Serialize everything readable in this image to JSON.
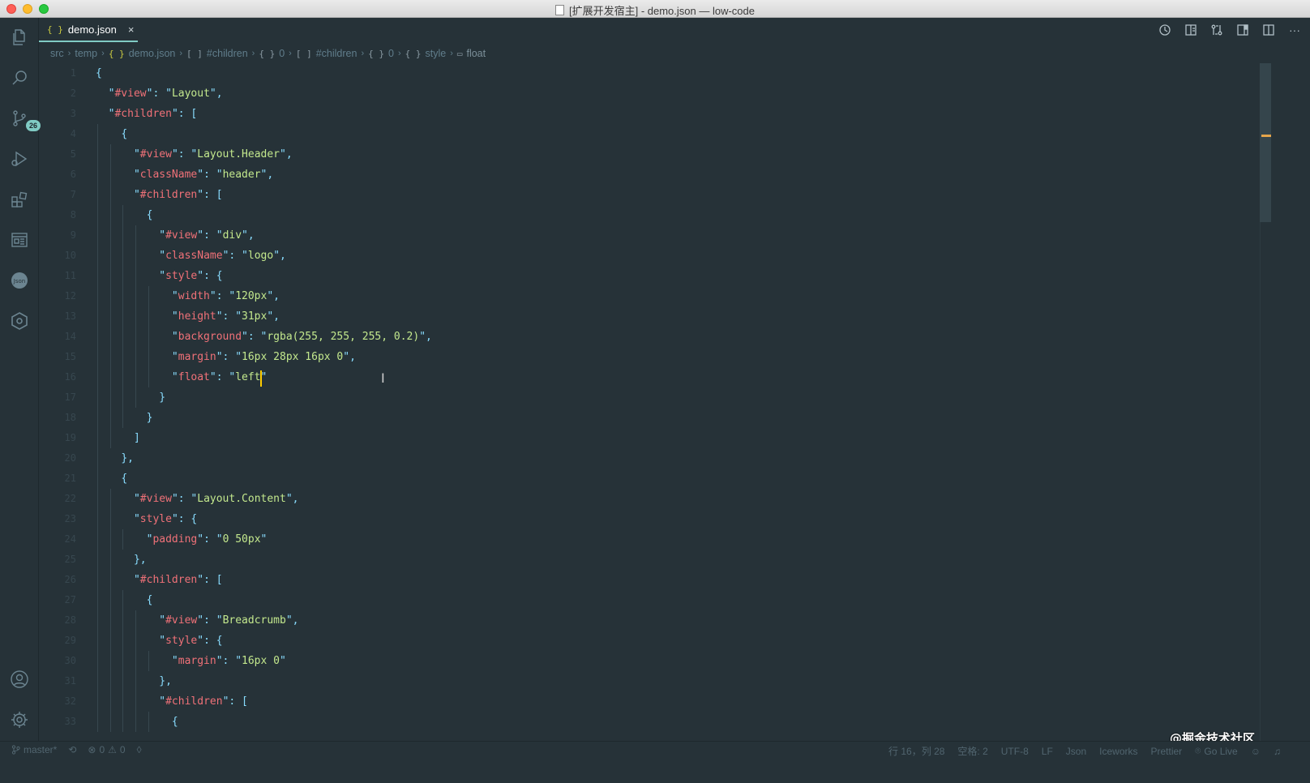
{
  "window": {
    "title": "[扩展开发宿主] - demo.json — low-code"
  },
  "activity_bar": {
    "items": [
      "files-icon",
      "search-icon",
      "source-control-icon",
      "run-debug-icon",
      "extensions-icon",
      "preview-icon",
      "json-icon",
      "iceworks-icon"
    ],
    "source_control_badge": "26",
    "bottom_items": [
      "account-icon",
      "settings-gear-icon"
    ]
  },
  "tabs": [
    {
      "icon": "{ }",
      "label": "demo.json",
      "close": "×"
    }
  ],
  "editor_actions": [
    "history-icon",
    "open-preview-icon",
    "compare-icon",
    "toggle-layout-icon",
    "split-editor-icon",
    "more-actions-icon"
  ],
  "breadcrumb": [
    {
      "icon": "",
      "label": "src"
    },
    {
      "icon": "",
      "label": "temp"
    },
    {
      "icon": "{ }",
      "label": "demo.json"
    },
    {
      "icon": "[ ]",
      "label": "#children"
    },
    {
      "icon": "{ }",
      "label": "0"
    },
    {
      "icon": "[ ]",
      "label": "#children"
    },
    {
      "icon": "{ }",
      "label": "0"
    },
    {
      "icon": "{ }",
      "label": "style"
    },
    {
      "icon": "▭",
      "label": "float"
    }
  ],
  "code_lines": [
    {
      "n": "1",
      "text": "{"
    },
    {
      "n": "2",
      "text": "  \"#view\": \"Layout\","
    },
    {
      "n": "3",
      "text": "  \"#children\": ["
    },
    {
      "n": "4",
      "text": "    {"
    },
    {
      "n": "5",
      "text": "      \"#view\": \"Layout.Header\","
    },
    {
      "n": "6",
      "text": "      \"className\": \"header\","
    },
    {
      "n": "7",
      "text": "      \"#children\": ["
    },
    {
      "n": "8",
      "text": "        {"
    },
    {
      "n": "9",
      "text": "          \"#view\": \"div\","
    },
    {
      "n": "10",
      "text": "          \"className\": \"logo\","
    },
    {
      "n": "11",
      "text": "          \"style\": {"
    },
    {
      "n": "12",
      "text": "            \"width\": \"120px\","
    },
    {
      "n": "13",
      "text": "            \"height\": \"31px\","
    },
    {
      "n": "14",
      "text": "            \"background\": \"rgba(255, 255, 255, 0.2)\","
    },
    {
      "n": "15",
      "text": "            \"margin\": \"16px 28px 16px 0\","
    },
    {
      "n": "16",
      "text": "            \"float\": \"left\""
    },
    {
      "n": "17",
      "text": "          }"
    },
    {
      "n": "18",
      "text": "        }"
    },
    {
      "n": "19",
      "text": "      ]"
    },
    {
      "n": "20",
      "text": "    },"
    },
    {
      "n": "21",
      "text": "    {"
    },
    {
      "n": "22",
      "text": "      \"#view\": \"Layout.Content\","
    },
    {
      "n": "23",
      "text": "      \"style\": {"
    },
    {
      "n": "24",
      "text": "        \"padding\": \"0 50px\""
    },
    {
      "n": "25",
      "text": "      },"
    },
    {
      "n": "26",
      "text": "      \"#children\": ["
    },
    {
      "n": "27",
      "text": "        {"
    },
    {
      "n": "28",
      "text": "          \"#view\": \"Breadcrumb\","
    },
    {
      "n": "29",
      "text": "          \"style\": {"
    },
    {
      "n": "30",
      "text": "            \"margin\": \"16px 0\""
    },
    {
      "n": "31",
      "text": "          },"
    },
    {
      "n": "32",
      "text": "          \"#children\": ["
    },
    {
      "n": "33",
      "text": "            {"
    }
  ],
  "status_bar": {
    "branch": "master*",
    "sync": "⟲",
    "errors": "0",
    "warnings": "0",
    "position": "行 16，列 28",
    "indent": "空格: 2",
    "encoding": "UTF-8",
    "eol": "LF",
    "language": "Json",
    "iceworks": "Iceworks",
    "prettier": "Prettier",
    "go_live": "Go Live"
  },
  "watermark": "@掘金技术社区",
  "colors": {
    "background": "#263238",
    "accent": "#80cbc4",
    "key": "#f07178",
    "string": "#c3e88d",
    "punctuation": "#89ddff",
    "cursor": "#ffcc00"
  }
}
